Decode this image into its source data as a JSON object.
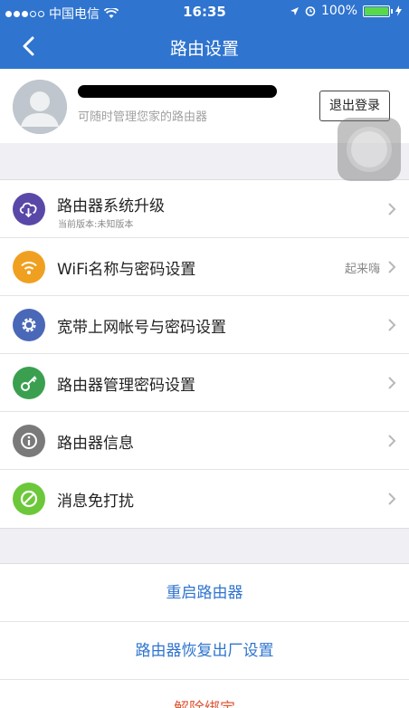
{
  "status_bar": {
    "carrier": "中国电信",
    "time": "16:35",
    "battery": "100%"
  },
  "nav": {
    "title": "路由设置"
  },
  "profile": {
    "subtitle": "可随时管理您家的路由器",
    "logout_label": "退出登录"
  },
  "settings": {
    "items": [
      {
        "label": "路由器系统升级",
        "sub": "当前版本:未知版本",
        "value": "",
        "icon": "cloud-download-icon",
        "color": "#5a48a8"
      },
      {
        "label": "WiFi名称与密码设置",
        "sub": "",
        "value": "起来嗨",
        "icon": "wifi-icon",
        "color": "#f0a020"
      },
      {
        "label": "宽带上网帐号与密码设置",
        "sub": "",
        "value": "",
        "icon": "gear-icon",
        "color": "#4a68b8"
      },
      {
        "label": "路由器管理密码设置",
        "sub": "",
        "value": "",
        "icon": "key-icon",
        "color": "#3aa050"
      },
      {
        "label": "路由器信息",
        "sub": "",
        "value": "",
        "icon": "info-icon",
        "color": "#7a7a7a"
      },
      {
        "label": "消息免打扰",
        "sub": "",
        "value": "",
        "icon": "do-not-disturb-icon",
        "color": "#6cc83a"
      }
    ]
  },
  "actions": {
    "restart_label": "重启路由器",
    "reset_label": "路由器恢复出厂设置",
    "unbind_label": "解除绑定"
  }
}
